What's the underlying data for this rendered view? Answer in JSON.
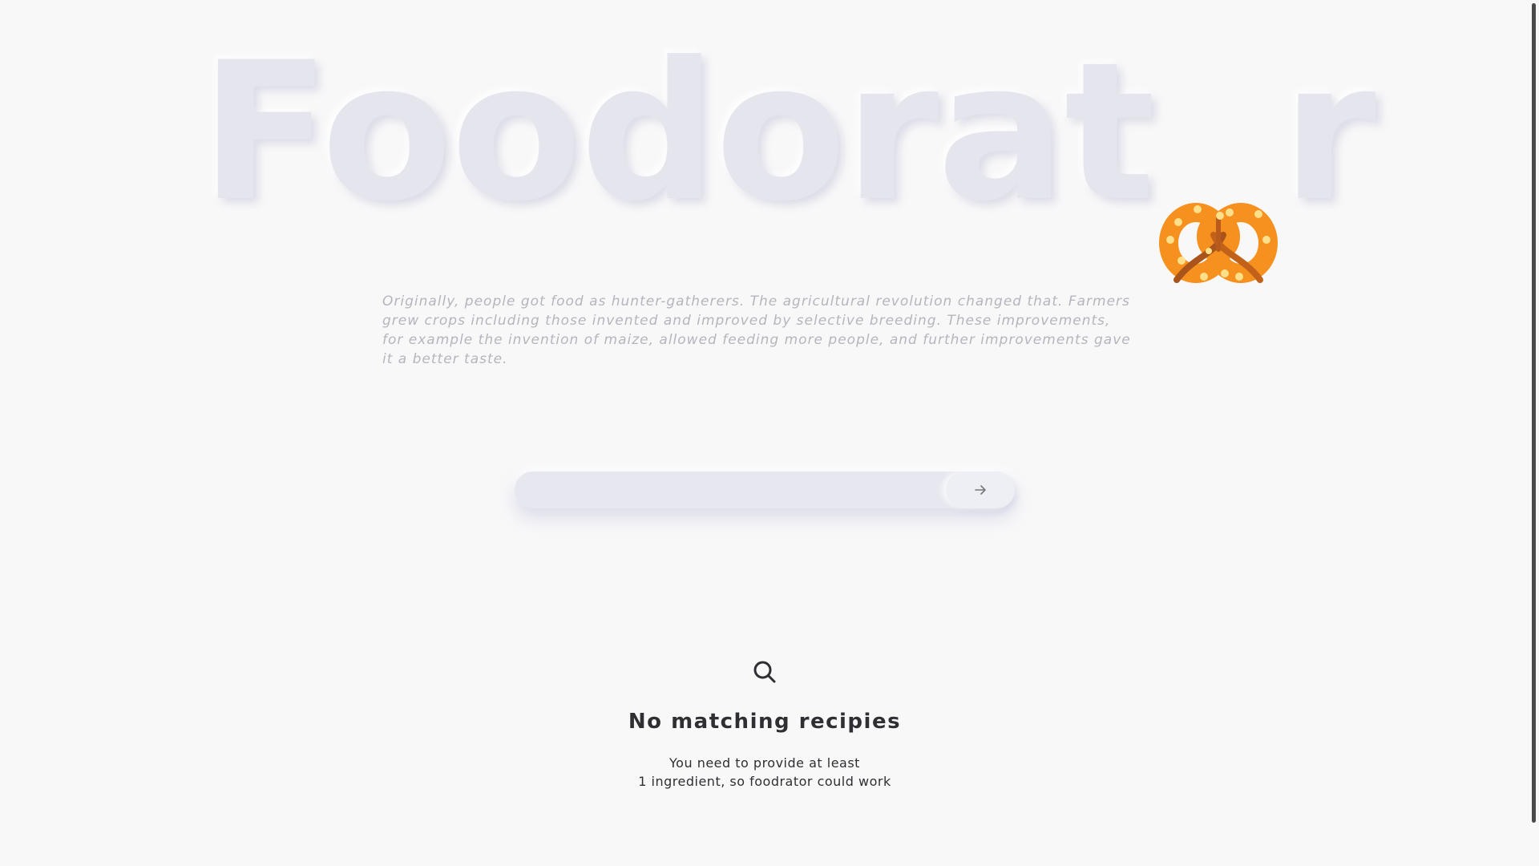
{
  "logo": {
    "text_before": "Foodorat",
    "text_after": "r",
    "icon": "pretzel-icon"
  },
  "description": "Originally, people got food as hunter-gatherers. The agricultural revolution changed that. Farmers grew crops including those invented and improved by selective breeding. These improvements, for example the invention of maize, allowed feeding more people, and further improvements gave it a better taste.",
  "search": {
    "value": "",
    "placeholder": "",
    "submit_icon": "arrow-right-icon"
  },
  "empty_state": {
    "icon": "search-icon",
    "title": "No matching recipies",
    "line1": "You need to provide at least",
    "line2": "1 ingredient, so foodrator could work"
  },
  "colors": {
    "background": "#f8f8f9",
    "logo_text": "#e4e5ed",
    "pretzel": "#f6901e",
    "pretzel_dots": "#ffe08a",
    "description_text": "#b5b5bd",
    "heading_text": "#2f2f33"
  }
}
